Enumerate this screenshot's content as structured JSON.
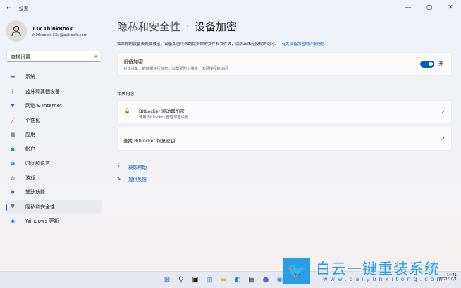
{
  "window": {
    "title": "设置",
    "back_icon": "arrow-left-icon",
    "minimize": "—",
    "maximize": "▢",
    "close": "✕"
  },
  "user": {
    "name": "13x ThinkBook",
    "email": "thinkbook-13x@outlook.com"
  },
  "search": {
    "placeholder": "查找设置",
    "icon": "search-icon"
  },
  "sidebar": {
    "items": [
      {
        "label": "系统",
        "icon": "monitor-icon",
        "color": "#2b7bd1"
      },
      {
        "label": "蓝牙和其他设备",
        "icon": "bluetooth-icon",
        "color": "#0a6fd8"
      },
      {
        "label": "网络 & Internet",
        "icon": "wifi-icon",
        "color": "#2a66c8"
      },
      {
        "label": "个性化",
        "icon": "brush-icon",
        "color": "#d9802b"
      },
      {
        "label": "应用",
        "icon": "apps-icon",
        "color": "#555"
      },
      {
        "label": "帐户",
        "icon": "person-icon",
        "color": "#1ea67a"
      },
      {
        "label": "时间和语言",
        "icon": "globe-clock-icon",
        "color": "#2b8ad1"
      },
      {
        "label": "游戏",
        "icon": "gamepad-icon",
        "color": "#777"
      },
      {
        "label": "辅助功能",
        "icon": "accessibility-icon",
        "color": "#1c6fd0"
      },
      {
        "label": "隐私和安全性",
        "icon": "shield-icon",
        "color": "#777",
        "active": true
      },
      {
        "label": "Windows 更新",
        "icon": "update-icon",
        "color": "#1a73d9"
      }
    ]
  },
  "main": {
    "breadcrumb_parent": "隐私和安全性",
    "breadcrumb_sep": "›",
    "title": "设备加密",
    "description": "如果你的设备丢失或被盗，设备加密可帮助保护你的文件和文件夹，以防止未经授权的访问。",
    "learn_more": "有关设备加密的详细信息",
    "encryption": {
      "title": "设备加密",
      "subtitle": "对该设备上的数据进行加密，以帮助防止脱机、未经授权的访问",
      "toggle_on": true,
      "toggle_label": "开",
      "accent": "#005fb8"
    },
    "related_header": "相关内容",
    "related": [
      {
        "title": "BitLocker 驱动器加密",
        "subtitle": "使用 BitLocker 管理加密设置",
        "icon": "drive-lock-icon"
      },
      {
        "title": "查找 BitLocker 恢复密钥"
      }
    ],
    "get_help": "获取帮助",
    "feedback": "提供反馈"
  },
  "taskbar": {
    "time": "14:41",
    "date": "2021/10/1",
    "icons": [
      "windows-start-icon",
      "search-icon",
      "task-view-icon",
      "widgets-icon",
      "file-explorer-icon",
      "edge-icon",
      "store-icon",
      "app-icon",
      "app-icon",
      "settings-icon"
    ]
  },
  "watermark": {
    "text": "白云一键重装系统",
    "url": "www.baiyunxitong.com"
  }
}
